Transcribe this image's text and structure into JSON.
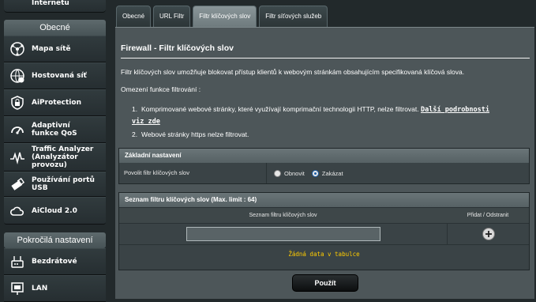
{
  "sidebar": {
    "top_item": "Internetu",
    "section_general": "Obecné",
    "general_items": [
      {
        "label": "Mapa sítě",
        "icon": "network-map-icon"
      },
      {
        "label": "Hostovaná síť",
        "icon": "guest-network-icon"
      },
      {
        "label": "AiProtection",
        "icon": "aiprotection-shield-icon"
      },
      {
        "label": "Adaptivní funkce QoS",
        "icon": "qos-gauge-icon"
      },
      {
        "label": "Traffic Analyzer (Analyzátor provozu)",
        "icon": "traffic-analyzer-icon"
      },
      {
        "label": "Používání portů USB",
        "icon": "usb-icon"
      },
      {
        "label": "AiCloud 2.0",
        "icon": "cloud-icon"
      }
    ],
    "section_advanced": "Pokročilá nastavení",
    "advanced_items": [
      {
        "label": "Bezdrátové",
        "icon": "wireless-icon"
      },
      {
        "label": "LAN",
        "icon": "lan-icon"
      }
    ]
  },
  "tabs": [
    {
      "label": "Obecné",
      "active": false
    },
    {
      "label": "URL Filtr",
      "active": false
    },
    {
      "label": "Filtr klíčových slov",
      "active": true
    },
    {
      "label": "Filtr síťových služeb",
      "active": false
    }
  ],
  "main": {
    "title": "Firewall - Filtr klíčových slov",
    "description": "Filtr klíčových slov umožňuje blokovat přístup klientů k webovým stránkám obsahujícím specifikovaná klíčová slova.",
    "limits_heading": "Omezení funkce filtrování :",
    "limits": {
      "item1_text": "Komprimované webové stránky, které využívají komprimační technologii HTTP, nelze filtrovat.",
      "item1_link": "Další podrobnosti viz zde",
      "item2_text": "Webové stránky https nelze filtrovat."
    },
    "basic_settings": {
      "header": "Základní nastavení",
      "enable_label": "Povolit filtr klíčových slov",
      "option_on": "Obnovit",
      "option_off": "Zakázat",
      "selected": "Zakázat"
    },
    "keyword_list": {
      "header": "Seznam filtru klíčových slov (Max. limit : 64)",
      "col_keyword": "Seznam filtru klíčových slov",
      "col_action": "Přidat / Odstranit",
      "input_value": "",
      "empty_text": "Žádná data v tabulce"
    },
    "apply_label": "Použít"
  },
  "colors": {
    "background": "#22292b",
    "panel": "#4d5659",
    "empty_text": "#ffcc00",
    "radio_selected": "#1c5ea8"
  }
}
